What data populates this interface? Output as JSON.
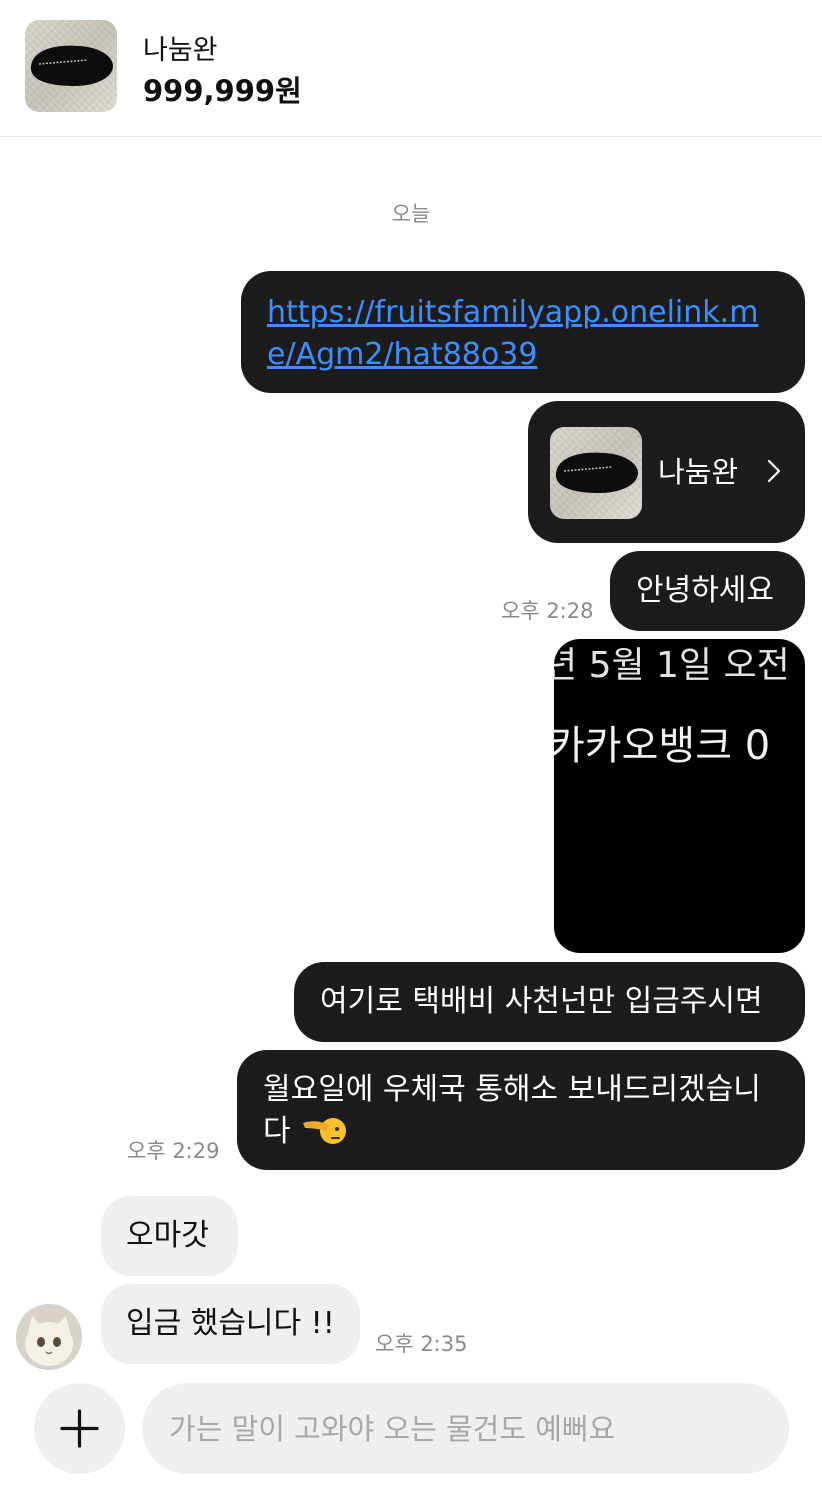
{
  "header": {
    "product_title": "나눔완",
    "price": "999,999원"
  },
  "date_divider": "오늘",
  "messages": {
    "link_url": "https://fruitsfamilyapp.onelink.me/Agm2/hat88o39",
    "product_card_title": "나눔완",
    "greeting": "안녕하세요",
    "greeting_time": "오후 2:28",
    "image_text_line1": "년 5월 1일 오전",
    "image_text_line2": "카카오뱅크 0",
    "delivery_msg": "여기로 택배비 사천넌만 입금주시면",
    "monday_msg_line1": "월요일에 우체국 통해소 보내드리겠습니",
    "monday_msg_line2": "다",
    "monday_msg_time": "오후 2:29",
    "reply_omg": "오마갓",
    "reply_paid": "입금 했습니다 !!",
    "reply_time": "오후 2:35"
  },
  "composer": {
    "placeholder": "가는 말이 고와야 오는 물건도 예뻐요",
    "value": ""
  },
  "colors": {
    "sent_bubble": "#1c1c1c",
    "received_bubble": "#efefef",
    "link": "#3d8fff",
    "timestamp": "#8a8a8a"
  },
  "icons": {
    "plus": "plus-icon",
    "chevron": "chevron-right-icon",
    "emoji": "salute-emoji-icon"
  }
}
